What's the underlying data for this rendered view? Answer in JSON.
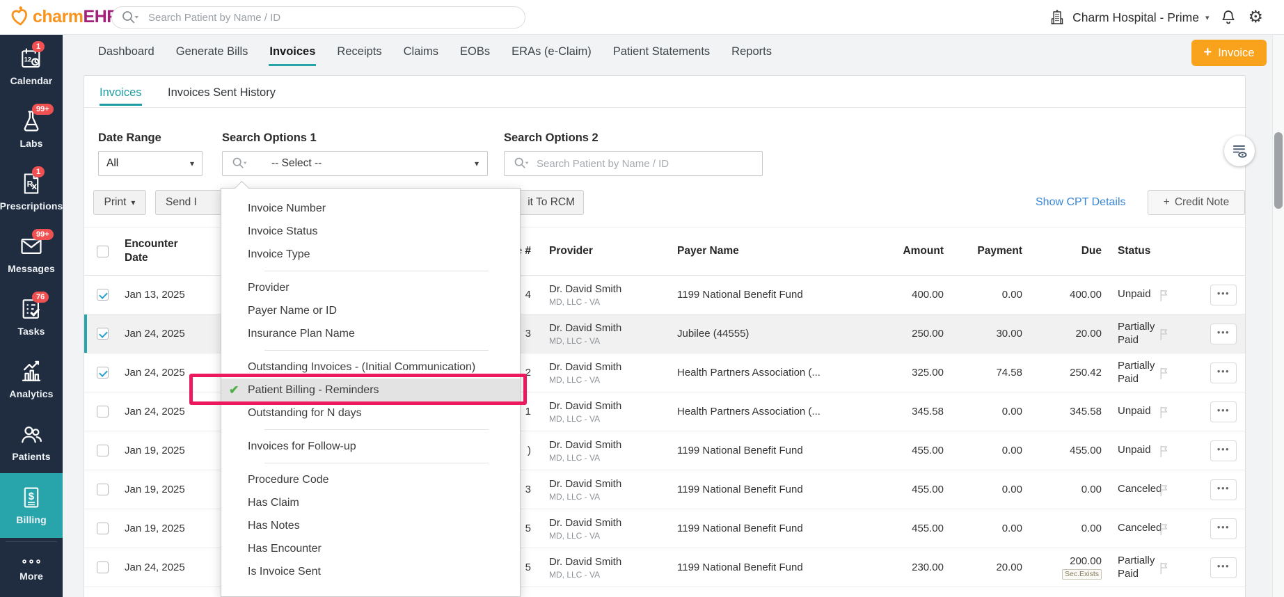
{
  "topbar": {
    "logo_charm": "charm",
    "logo_ehr": "EHR",
    "search_placeholder": "Search Patient by Name / ID",
    "org_name": "Charm Hospital - Prime"
  },
  "sidebar": {
    "items": [
      {
        "label": "Calendar",
        "badge": "1",
        "icon": "calendar"
      },
      {
        "label": "Labs",
        "badge": "99+",
        "icon": "labs"
      },
      {
        "label": "Prescriptions",
        "badge": "1",
        "icon": "prescriptions"
      },
      {
        "label": "Messages",
        "badge": "99+",
        "icon": "messages"
      },
      {
        "label": "Tasks",
        "badge": "76",
        "icon": "tasks"
      },
      {
        "label": "Analytics",
        "badge": "",
        "icon": "analytics"
      },
      {
        "label": "Patients",
        "badge": "",
        "icon": "patients"
      },
      {
        "label": "Billing",
        "badge": "",
        "icon": "billing",
        "active": true
      },
      {
        "label": "More",
        "badge": "",
        "icon": "more",
        "divider_before": true
      }
    ]
  },
  "nav": {
    "tabs": [
      {
        "label": "Dashboard"
      },
      {
        "label": "Generate Bills"
      },
      {
        "label": "Invoices",
        "active": true
      },
      {
        "label": "Receipts"
      },
      {
        "label": "Claims"
      },
      {
        "label": "EOBs"
      },
      {
        "label": "ERAs (e-Claim)"
      },
      {
        "label": "Patient Statements"
      },
      {
        "label": "Reports"
      }
    ],
    "new_invoice_label": "Invoice"
  },
  "subtabs": {
    "items": [
      {
        "label": "Invoices",
        "active": true
      },
      {
        "label": "Invoices Sent History"
      }
    ]
  },
  "filters": {
    "date_range_label": "Date Range",
    "date_range_value": "All",
    "search1_label": "Search Options 1",
    "search1_value": "-- Select --",
    "search2_label": "Search Options 2",
    "search2_placeholder": "Search Patient by Name / ID"
  },
  "toolbar": {
    "print": "Print",
    "send_partial": "Send I",
    "rcm_partial": "it To RCM",
    "show_cpt": "Show CPT Details",
    "credit_note": "Credit Note"
  },
  "filter_dropdown": {
    "items": [
      {
        "label": "Invoice Number"
      },
      {
        "label": "Invoice Status"
      },
      {
        "label": "Invoice Type",
        "divider_after": true
      },
      {
        "label": "Provider"
      },
      {
        "label": "Payer Name or ID"
      },
      {
        "label": "Insurance Plan Name",
        "divider_after": true
      },
      {
        "label": "Outstanding Invoices - (Initial Communication)"
      },
      {
        "label": "Patient Billing - Reminders",
        "selected": true,
        "annotated": true
      },
      {
        "label": "Outstanding for N days",
        "divider_after": true
      },
      {
        "label": "Invoices for Follow-up",
        "divider_after": true
      },
      {
        "label": "Procedure Code"
      },
      {
        "label": "Has Claim"
      },
      {
        "label": "Has Notes"
      },
      {
        "label": "Has Encounter"
      },
      {
        "label": "Is Invoice Sent"
      }
    ]
  },
  "table": {
    "columns": {
      "encounter_date": "Encounter Date",
      "invoice": "Invoice #",
      "provider": "Provider",
      "payer": "Payer Name",
      "amount": "Amount",
      "payment": "Payment",
      "due": "Due",
      "status": "Status"
    },
    "rows": [
      {
        "checked": true,
        "selected": false,
        "encounter_date": "Jan 13, 2025",
        "invoice_tail": "4",
        "provider": "Dr. David Smith",
        "provider_sub": "MD, LLC - VA",
        "payer": "1199 National Benefit Fund",
        "amount": "400.00",
        "payment": "0.00",
        "due": "400.00",
        "status": "Unpaid"
      },
      {
        "checked": true,
        "selected": true,
        "encounter_date": "Jan 24, 2025",
        "invoice_tail": "3",
        "provider": "Dr. David Smith",
        "provider_sub": "MD, LLC - VA",
        "payer": "Jubilee (44555)",
        "amount": "250.00",
        "payment": "30.00",
        "due": "20.00",
        "status": "Partially Paid"
      },
      {
        "checked": true,
        "selected": false,
        "encounter_date": "Jan 24, 2025",
        "invoice_tail": "2",
        "provider": "Dr. David Smith",
        "provider_sub": "MD, LLC - VA",
        "payer": "Health Partners Association (...",
        "amount": "325.00",
        "payment": "74.58",
        "due": "250.42",
        "status": "Partially Paid"
      },
      {
        "checked": false,
        "selected": false,
        "encounter_date": "Jan 24, 2025",
        "invoice_tail": "1",
        "provider": "Dr. David Smith",
        "provider_sub": "MD, LLC - VA",
        "payer": "Health Partners Association (...",
        "amount": "345.58",
        "payment": "0.00",
        "due": "345.58",
        "status": "Unpaid"
      },
      {
        "checked": false,
        "selected": false,
        "encounter_date": "Jan 19, 2025",
        "invoice_tail": ")",
        "provider": "Dr. David Smith",
        "provider_sub": "MD, LLC - VA",
        "payer": "1199 National Benefit Fund",
        "amount": "455.00",
        "payment": "0.00",
        "due": "455.00",
        "status": "Unpaid"
      },
      {
        "checked": false,
        "selected": false,
        "encounter_date": "Jan 19, 2025",
        "invoice_tail": "3",
        "provider": "Dr. David Smith",
        "provider_sub": "MD, LLC - VA",
        "payer": "1199 National Benefit Fund",
        "amount": "455.00",
        "payment": "0.00",
        "due": "0.00",
        "status": "Canceled"
      },
      {
        "checked": false,
        "selected": false,
        "encounter_date": "Jan 19, 2025",
        "invoice_tail": "5",
        "provider": "Dr. David Smith",
        "provider_sub": "MD, LLC - VA",
        "payer": "1199 National Benefit Fund",
        "amount": "455.00",
        "payment": "0.00",
        "due": "0.00",
        "status": "Canceled"
      },
      {
        "checked": false,
        "selected": false,
        "encounter_date": "Jan 24, 2025",
        "invoice_tail": "5",
        "provider": "Dr. David Smith",
        "provider_sub": "MD, LLC - VA",
        "payer": "1199 National Benefit Fund",
        "amount": "230.00",
        "payment": "20.00",
        "due": "200.00",
        "due_badge": "Sec.Exists",
        "status": "Partially Paid"
      }
    ]
  },
  "colors": {
    "teal": "#27a5aa",
    "sidebar_bg": "#202d40",
    "badge_red": "#ef5051",
    "button_orange": "#f9a21c",
    "logo_orange": "#f7941e",
    "logo_magenta": "#a3217b",
    "link_blue": "#3787d8",
    "annotation_pink": "#ed195f",
    "check_green": "#4db043"
  }
}
